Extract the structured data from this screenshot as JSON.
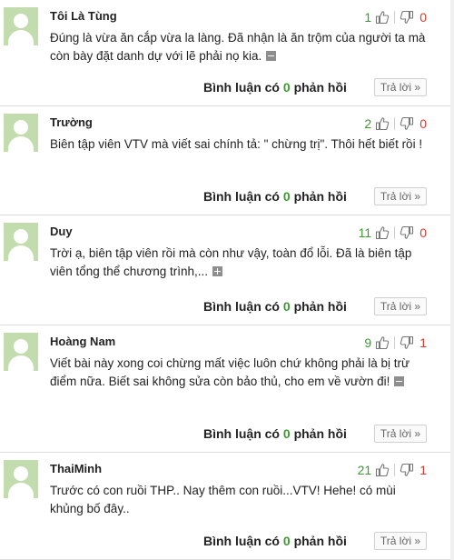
{
  "comments": [
    {
      "author": "Tôi Là Tùng",
      "likes": "1",
      "dislikes": "0",
      "text": "Đúng là vừa ăn cắp vừa la làng. Đã nhận là ăn trộm của người ta mà còn bày đặt danh dự với lẽ phải nọ kia.",
      "toggle": "collapse",
      "reply_count_prefix": "Bình luận có",
      "reply_count": "0",
      "reply_count_suffix": "phản hồi",
      "reply_label": "Trả lời »"
    },
    {
      "author": "Trường",
      "likes": "2",
      "dislikes": "0",
      "text": "Biên tập viên VTV mà viết sai chính tả: \" chừng trị\". Thôi hết biết rồi !",
      "toggle": "none",
      "reply_count_prefix": "Bình luận có",
      "reply_count": "0",
      "reply_count_suffix": "phản hồi",
      "reply_label": "Trả lời »"
    },
    {
      "author": "Duy",
      "likes": "11",
      "dislikes": "0",
      "text": "Trời ạ, biên tập viên rồi mà còn như vậy, toàn đổ lỗi. Đã là biên tập viên tổng thể chương trình,...",
      "toggle": "expand",
      "reply_count_prefix": "Bình luận có",
      "reply_count": "0",
      "reply_count_suffix": "phản hồi",
      "reply_label": "Trả lời »"
    },
    {
      "author": "Hoàng Nam",
      "likes": "9",
      "dislikes": "1",
      "text": "Viết bài này xong coi chừng mất việc luôn chứ không phải là bị trừ điểm nữa. Biết sai không sửa còn bảo thủ, cho em về vườn đi!",
      "toggle": "collapse",
      "reply_count_prefix": "Bình luận có",
      "reply_count": "0",
      "reply_count_suffix": "phản hồi",
      "reply_label": "Trả lời »"
    },
    {
      "author": "ThaiMinh",
      "likes": "21",
      "dislikes": "1",
      "text": "Trước có con ruồi THP.. Nay thêm con ruồi...VTV! Hehe! có mùi khủng bố đây..",
      "toggle": "none",
      "reply_count_prefix": "Bình luận có",
      "reply_count": "0",
      "reply_count_suffix": "phản hồi",
      "reply_label": "Trả lời »"
    }
  ],
  "icons": {
    "like": "thumbs-up-icon",
    "dislike": "thumbs-down-icon",
    "avatar": "default-user-avatar"
  },
  "colors": {
    "likes": "#3a9a2e",
    "dislikes": "#d23b2b",
    "reply_count": "#3a9a2e",
    "avatar": "#c3dcae"
  }
}
